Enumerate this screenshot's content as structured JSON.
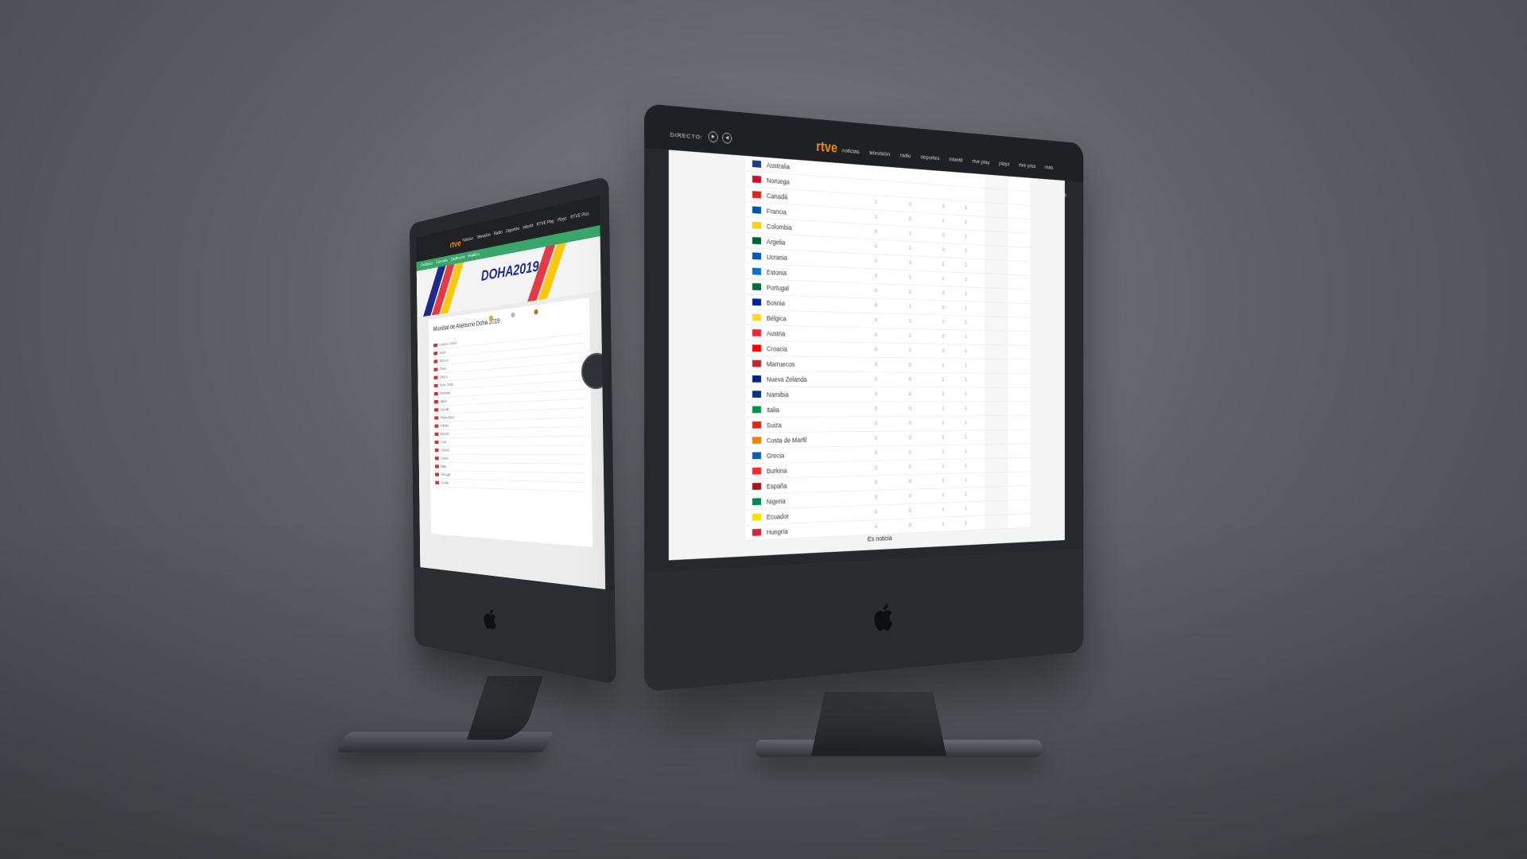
{
  "left_screen": {
    "logo": "rtve",
    "nav": [
      "Noticias",
      "Televisión",
      "Radio",
      "Deportes",
      "Infantil",
      "RTVE Play",
      "Playz",
      "RTVE Plus"
    ],
    "subnav": [
      "Resultados",
      "Calendario",
      "Clasificación",
      "Medallero"
    ],
    "banner_title": "DOHA2019",
    "page_title": "Mundial de Atletismo Doha 2019",
    "rows": [
      "Estados Unidos",
      "Kenia",
      "Jamaica",
      "China",
      "Etiopía",
      "Reino Unido",
      "Alemania",
      "Japón",
      "Uganda",
      "Países Bajos",
      "Polonia",
      "Bahréin",
      "Cuba",
      "Canadá",
      "Suecia",
      "Italia",
      "Portugal",
      "Irlanda"
    ]
  },
  "right_screen": {
    "directo_label": "DIRECTO:",
    "logo": "rtve",
    "nav": [
      "noticias",
      "televisión",
      "radio",
      "deportes",
      "infantil",
      "rtve play",
      "playz",
      "rtve plus",
      "más"
    ],
    "rows": [
      {
        "country": "Australia",
        "flag": "#1f3c88",
        "g": "",
        "s": "",
        "b": "",
        "t": ""
      },
      {
        "country": "Noruega",
        "flag": "#c8102e",
        "g": "",
        "s": "",
        "b": "",
        "t": ""
      },
      {
        "country": "Canadá",
        "flag": "#d52b1e",
        "g": "1",
        "s": "0",
        "b": "3",
        "t": "4"
      },
      {
        "country": "Francia",
        "flag": "#0055a4",
        "g": "1",
        "s": "0",
        "b": "1",
        "t": "2"
      },
      {
        "country": "Colombia",
        "flag": "#fcd116",
        "g": "0",
        "s": "1",
        "b": "0",
        "t": "1"
      },
      {
        "country": "Argelia",
        "flag": "#006233",
        "g": "0",
        "s": "1",
        "b": "0",
        "t": "1"
      },
      {
        "country": "Ucrania",
        "flag": "#0057b7",
        "g": "0",
        "s": "1",
        "b": "1",
        "t": "2"
      },
      {
        "country": "Estonia",
        "flag": "#0072ce",
        "g": "0",
        "s": "1",
        "b": "1",
        "t": "2"
      },
      {
        "country": "Portugal",
        "flag": "#046a38",
        "g": "0",
        "s": "1",
        "b": "0",
        "t": "1"
      },
      {
        "country": "Bosnia",
        "flag": "#002395",
        "g": "0",
        "s": "1",
        "b": "0",
        "t": "1"
      },
      {
        "country": "Bélgica",
        "flag": "#fdda24",
        "g": "0",
        "s": "1",
        "b": "0",
        "t": "1"
      },
      {
        "country": "Austria",
        "flag": "#ed2939",
        "g": "0",
        "s": "1",
        "b": "0",
        "t": "1"
      },
      {
        "country": "Croacia",
        "flag": "#ff0000",
        "g": "0",
        "s": "1",
        "b": "0",
        "t": "1"
      },
      {
        "country": "Marruecos",
        "flag": "#c1272d",
        "g": "0",
        "s": "0",
        "b": "1",
        "t": "1"
      },
      {
        "country": "Nueva Zelanda",
        "flag": "#00247d",
        "g": "0",
        "s": "0",
        "b": "1",
        "t": "1"
      },
      {
        "country": "Namibia",
        "flag": "#003580",
        "g": "0",
        "s": "0",
        "b": "1",
        "t": "1"
      },
      {
        "country": "Italia",
        "flag": "#009246",
        "g": "0",
        "s": "0",
        "b": "1",
        "t": "1"
      },
      {
        "country": "Suiza",
        "flag": "#da291c",
        "g": "0",
        "s": "0",
        "b": "1",
        "t": "1"
      },
      {
        "country": "Costa de Marfil",
        "flag": "#f77f00",
        "g": "0",
        "s": "0",
        "b": "1",
        "t": "1"
      },
      {
        "country": "Grecia",
        "flag": "#0d5eaf",
        "g": "0",
        "s": "0",
        "b": "1",
        "t": "1"
      },
      {
        "country": "Burkina",
        "flag": "#ef2b2d",
        "g": "0",
        "s": "0",
        "b": "1",
        "t": "1"
      },
      {
        "country": "España",
        "flag": "#aa151b",
        "g": "0",
        "s": "0",
        "b": "1",
        "t": "1"
      },
      {
        "country": "Nigeria",
        "flag": "#008751",
        "g": "0",
        "s": "0",
        "b": "1",
        "t": "1"
      },
      {
        "country": "Ecuador",
        "flag": "#ffdd00",
        "g": "0",
        "s": "0",
        "b": "1",
        "t": "1"
      },
      {
        "country": "Hungría",
        "flag": "#ce2939",
        "g": "0",
        "s": "0",
        "b": "1",
        "t": "1"
      }
    ],
    "footer": "Es noticia"
  },
  "colors": {
    "accent_orange": "#f28b1e",
    "green_bar": "#3aa56b",
    "doha_blue": "#1e2a8a"
  }
}
